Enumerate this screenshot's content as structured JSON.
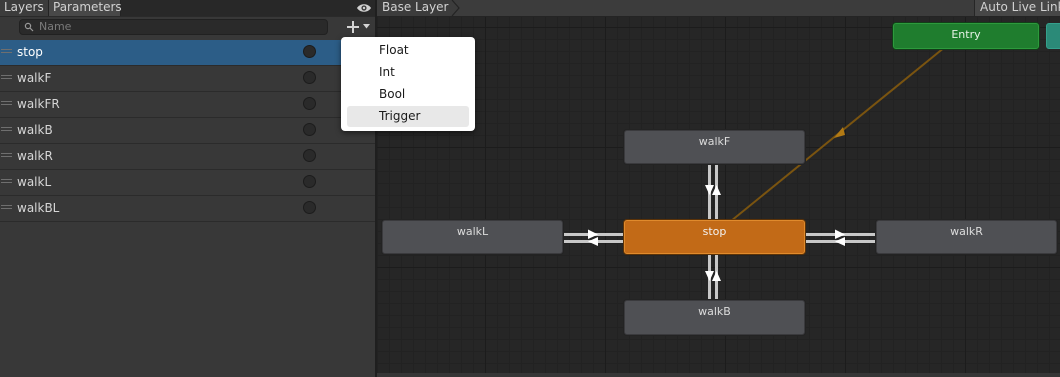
{
  "tabs": {
    "layers": "Layers",
    "parameters": "Parameters"
  },
  "search": {
    "placeholder": "Name"
  },
  "parameters": [
    {
      "name": "stop",
      "selected": true
    },
    {
      "name": "walkF",
      "selected": false
    },
    {
      "name": "walkFR",
      "selected": false
    },
    {
      "name": "walkB",
      "selected": false
    },
    {
      "name": "walkR",
      "selected": false
    },
    {
      "name": "walkL",
      "selected": false
    },
    {
      "name": "walkBL",
      "selected": false
    }
  ],
  "type_menu": {
    "items": [
      "Float",
      "Int",
      "Bool",
      "Trigger"
    ],
    "highlighted": "Trigger"
  },
  "graph": {
    "breadcrumb": "Base Layer",
    "auto_live_link": "Auto Live Link",
    "states": {
      "entry": "Entry",
      "stop": "stop",
      "walkF": "walkF",
      "walkL": "walkL",
      "walkR": "walkR",
      "walkB": "walkB"
    }
  },
  "colors": {
    "selected_row": "#2c5d87",
    "default_state": "#c26a17",
    "entry_state": "#1f7d2e",
    "state_node": "#4f5054",
    "entry_transition": "#7a5410"
  }
}
